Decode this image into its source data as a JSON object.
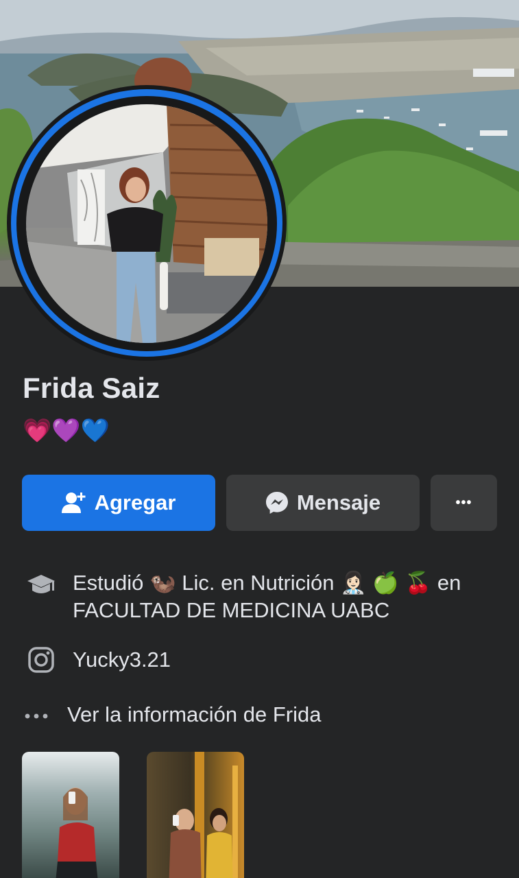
{
  "profile": {
    "name": "Frida Saiz",
    "bio_hearts": [
      {
        "glyph": "💗",
        "color": "#ff5fa8"
      },
      {
        "glyph": "💜",
        "color": "#a443f2"
      },
      {
        "glyph": "💙",
        "color": "#2f8cf5"
      }
    ]
  },
  "actions": {
    "add_label": "Agregar",
    "message_label": "Mensaje",
    "more_label": "•••"
  },
  "info": {
    "education": {
      "icon": "graduation-cap-icon",
      "prefix": "Estudió",
      "emoji1": "🦦",
      "degree": "Lic. en Nutrición",
      "emoji2": "👩🏻‍⚕️",
      "emoji3": "🍏",
      "emoji4": "🍒",
      "connector": "en",
      "school": "FACULTAD DE MEDICINA UABC"
    },
    "instagram": {
      "icon": "instagram-icon",
      "handle": "Yucky3.21"
    },
    "see_more": {
      "icon": "more-dots-icon",
      "label": "Ver la información de Frida"
    }
  },
  "colors": {
    "background": "#242526",
    "primary": "#1b74e4",
    "secondary_button": "#3a3b3c",
    "text": "#e4e6eb",
    "icon_gray": "#b0b3b8"
  }
}
